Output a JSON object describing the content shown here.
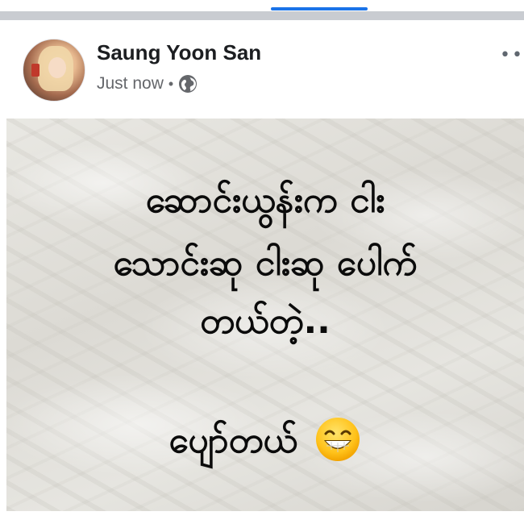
{
  "post": {
    "author": "Saung Yoon San",
    "timestamp": "Just now",
    "separator": "•",
    "more_label": "•••",
    "privacy_icon": "globe-icon",
    "text_lines": [
      "ဆောင်းယွန်းက ငါး",
      "သောင်းဆု ငါးဆု ပေါက်",
      "တယ်တဲ့..",
      "ပျော်တယ်"
    ],
    "emoji": "grinning-face-with-smiling-eyes-icon"
  },
  "colors": {
    "tab_indicator": "#1a73e8",
    "author_text": "#1c1e21",
    "meta_text": "#65676b"
  }
}
